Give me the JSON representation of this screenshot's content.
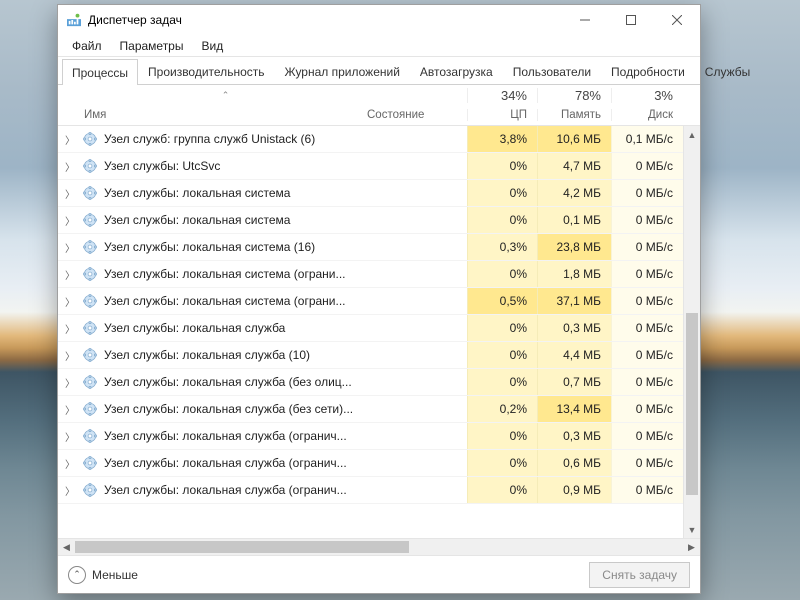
{
  "window": {
    "title": "Диспетчер задач"
  },
  "menu": {
    "file": "Файл",
    "options": "Параметры",
    "view": "Вид"
  },
  "tabs": {
    "processes": "Процессы",
    "performance": "Производительность",
    "apphistory": "Журнал приложений",
    "startup": "Автозагрузка",
    "users": "Пользователи",
    "details": "Подробности",
    "services": "Службы"
  },
  "columns": {
    "name": "Имя",
    "state": "Состояние",
    "cpu": "ЦП",
    "memory": "Память",
    "disk": "Диск",
    "cpu_pct": "34%",
    "mem_pct": "78%",
    "disk_pct": "3%"
  },
  "rows": [
    {
      "name": "Узел служб: группа служб Unistack (6)",
      "cpu": "3,8%",
      "mem": "10,6 МБ",
      "disk": "0,1 МБ/с",
      "cpu_hot": true,
      "mem_hot": true
    },
    {
      "name": "Узел службы: UtcSvc",
      "cpu": "0%",
      "mem": "4,7 МБ",
      "disk": "0 МБ/с"
    },
    {
      "name": "Узел службы: локальная система",
      "cpu": "0%",
      "mem": "4,2 МБ",
      "disk": "0 МБ/с"
    },
    {
      "name": "Узел службы: локальная система",
      "cpu": "0%",
      "mem": "0,1 МБ",
      "disk": "0 МБ/с"
    },
    {
      "name": "Узел службы: локальная система (16)",
      "cpu": "0,3%",
      "mem": "23,8 МБ",
      "disk": "0 МБ/с",
      "mem_hot": true
    },
    {
      "name": "Узел службы: локальная система (ограни...",
      "cpu": "0%",
      "mem": "1,8 МБ",
      "disk": "0 МБ/с"
    },
    {
      "name": "Узел службы: локальная система (ограни...",
      "cpu": "0,5%",
      "mem": "37,1 МБ",
      "disk": "0 МБ/с",
      "cpu_hot": true,
      "mem_hot": true
    },
    {
      "name": "Узел службы: локальная служба",
      "cpu": "0%",
      "mem": "0,3 МБ",
      "disk": "0 МБ/с"
    },
    {
      "name": "Узел службы: локальная служба (10)",
      "cpu": "0%",
      "mem": "4,4 МБ",
      "disk": "0 МБ/с"
    },
    {
      "name": "Узел службы: локальная служба (без олиц...",
      "cpu": "0%",
      "mem": "0,7 МБ",
      "disk": "0 МБ/с"
    },
    {
      "name": "Узел службы: локальная служба (без сети)...",
      "cpu": "0,2%",
      "mem": "13,4 МБ",
      "disk": "0 МБ/с",
      "mem_hot": true
    },
    {
      "name": "Узел службы: локальная служба (огранич...",
      "cpu": "0%",
      "mem": "0,3 МБ",
      "disk": "0 МБ/с"
    },
    {
      "name": "Узел службы: локальная служба (огранич...",
      "cpu": "0%",
      "mem": "0,6 МБ",
      "disk": "0 МБ/с"
    },
    {
      "name": "Узел службы: локальная служба (огранич...",
      "cpu": "0%",
      "mem": "0,9 МБ",
      "disk": "0 МБ/с"
    }
  ],
  "footer": {
    "fewer": "Меньше",
    "endtask": "Снять задачу"
  }
}
